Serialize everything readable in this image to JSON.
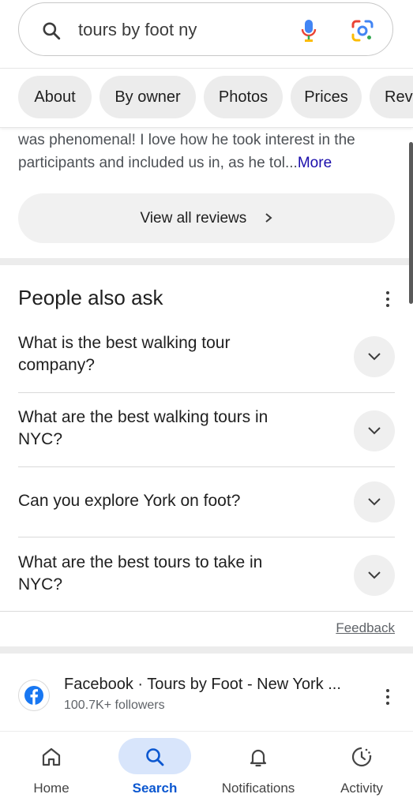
{
  "search": {
    "query": "tours by foot ny"
  },
  "chips": [
    "About",
    "By owner",
    "Photos",
    "Prices",
    "Rev"
  ],
  "review": {
    "line1": "was phenomenal! I love how he took interest in the",
    "line2": "participants and included us in, as he tol...",
    "more": "More",
    "view_all": "View all reviews"
  },
  "paa": {
    "title": "People also ask",
    "questions": [
      [
        "What is the best walking tour",
        "company?"
      ],
      [
        "What are the best walking tours in",
        "NYC?"
      ],
      [
        "Can you explore York on foot?",
        ""
      ],
      [
        "What are the best tours to take in",
        "NYC?"
      ]
    ],
    "feedback": "Feedback"
  },
  "result": {
    "title": "Facebook · Tours by Foot - New York ...",
    "subtitle": "100.7K+ followers"
  },
  "nav": {
    "items": [
      {
        "label": "Home",
        "icon": "home-icon"
      },
      {
        "label": "Search",
        "icon": "search-icon",
        "active": true
      },
      {
        "label": "Notifications",
        "icon": "bell-icon"
      },
      {
        "label": "Activity",
        "icon": "activity-icon"
      }
    ]
  },
  "colors": {
    "link": "#1a0dab",
    "active_nav": "#0b57d0",
    "active_pill": "#d8e5fb"
  }
}
